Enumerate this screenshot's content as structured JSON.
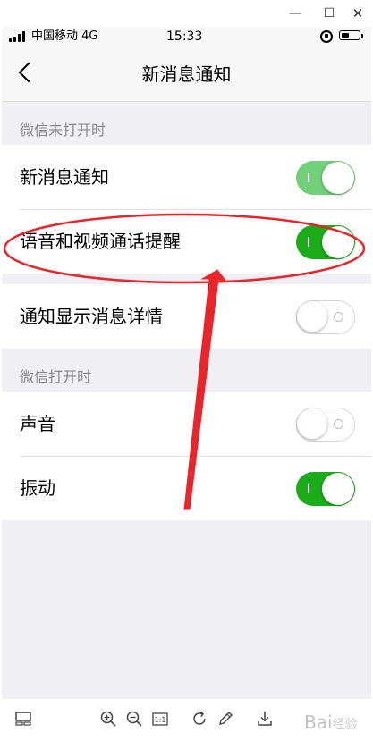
{
  "status_bar": {
    "carrier": "中国移动 4G",
    "time": "15:33"
  },
  "nav": {
    "title": "新消息通知"
  },
  "sections": {
    "wechat_closed_header": "微信未打开时",
    "wechat_open_header": "微信打开时"
  },
  "settings": {
    "new_message_notify": {
      "label": "新消息通知",
      "enabled": true
    },
    "voice_video_call_alert": {
      "label": "语音和视频通话提醒",
      "enabled": true
    },
    "show_message_details": {
      "label": "通知显示消息详情",
      "enabled": false
    },
    "sound": {
      "label": "声音",
      "enabled": false
    },
    "vibrate": {
      "label": "振动",
      "enabled": true
    }
  },
  "watermark": {
    "text": "Bai",
    "sub": "经验"
  },
  "colors": {
    "switch_on": "#1aad19",
    "switch_on_dimmed": "#72cf7a",
    "annotation_red": "#e8252b",
    "page_bg": "#efeff4"
  },
  "icons": {
    "toolbar": [
      "thumbnail-icon",
      "zoom-in-icon",
      "zoom-out-icon",
      "actual-size-icon",
      "rotate-icon",
      "edit-icon",
      "download-icon"
    ]
  }
}
